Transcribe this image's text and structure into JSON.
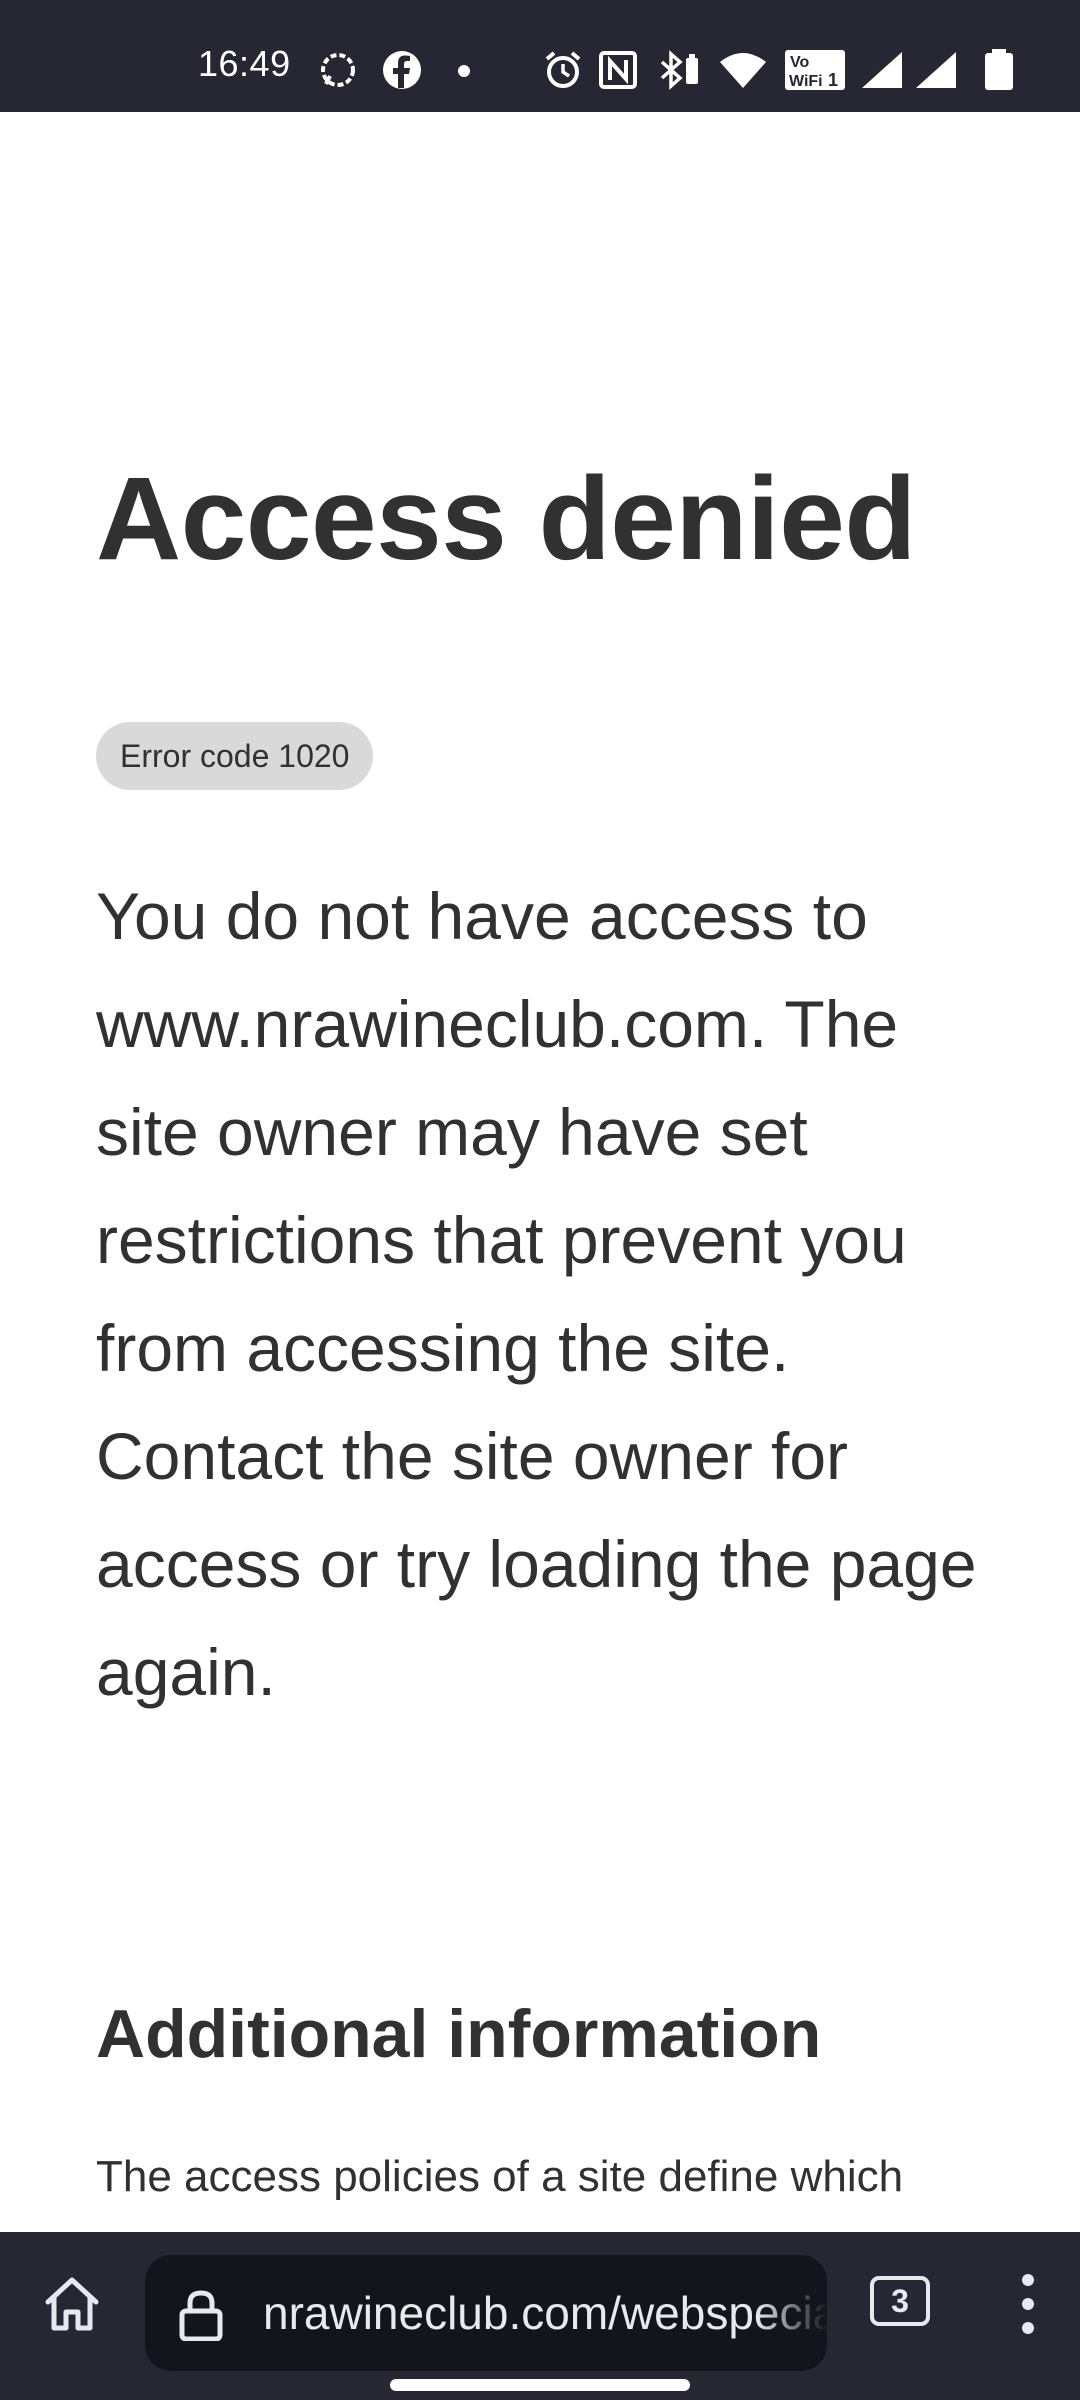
{
  "status_bar": {
    "time": "16:49",
    "icons": [
      "signal-messenger-icon",
      "facebook-icon",
      "notification-dot-icon",
      "alarm-icon",
      "nfc-icon",
      "bluetooth-battery-icon",
      "wifi-icon",
      "vowifi-icon",
      "cell-signal-icon",
      "cell-signal-2-icon",
      "battery-icon"
    ]
  },
  "page": {
    "title": "Access denied",
    "error_badge": "Error code 1020",
    "description": "You do not have access to www.nrawineclub.com. The site owner may have set restrictions that prevent you from accessing the site. Contact the site owner for access or try loading the page again.",
    "section_heading": "Additional information",
    "section_text": "The access policies of a site define which"
  },
  "browser_bar": {
    "url": "nrawineclub.com/webspecials",
    "tab_count": "3",
    "icons": [
      "home-icon",
      "lock-icon",
      "tab-switcher-icon",
      "more-vert-icon"
    ]
  },
  "colors": {
    "bar_background": "#272733",
    "url_pill_background": "#14141c",
    "text": "#313131",
    "badge_background": "#d9d9d9"
  }
}
